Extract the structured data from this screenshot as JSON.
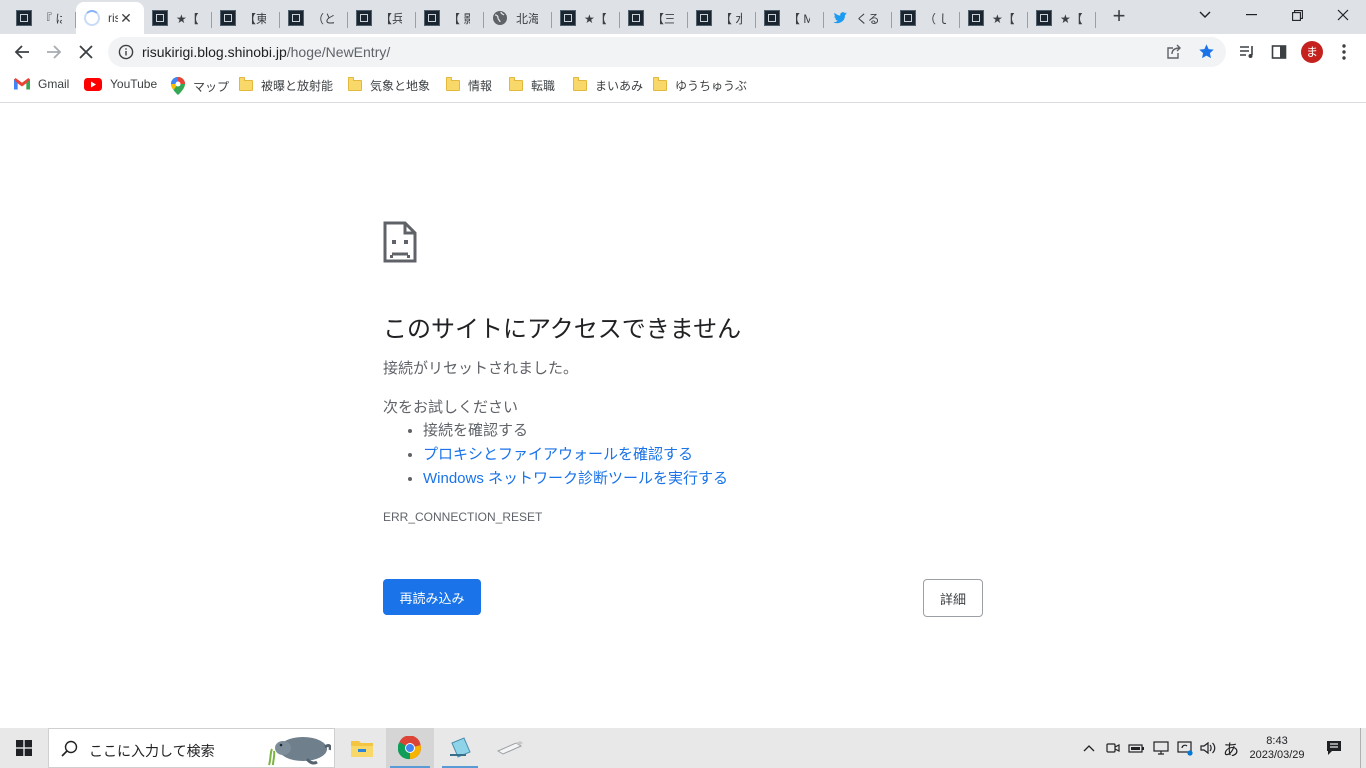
{
  "tabs": [
    {
      "title": "『 は",
      "favicon": "site"
    },
    {
      "title": "ris",
      "favicon": "loading-spinner",
      "active": true
    },
    {
      "title": "★【",
      "favicon": "site"
    },
    {
      "title": "【東京",
      "favicon": "site"
    },
    {
      "title": "（とり",
      "favicon": "site"
    },
    {
      "title": "【兵庫",
      "favicon": "site"
    },
    {
      "title": "【 影",
      "favicon": "site"
    },
    {
      "title": "北海道",
      "favicon": "globe-icon"
    },
    {
      "title": "★【",
      "favicon": "site"
    },
    {
      "title": "【三重",
      "favicon": "site"
    },
    {
      "title": "【 水",
      "favicon": "site"
    },
    {
      "title": "【 M",
      "favicon": "site"
    },
    {
      "title": "くるす",
      "favicon": "twitter-icon"
    },
    {
      "title": "（ し",
      "favicon": "site"
    },
    {
      "title": "★【",
      "favicon": "site"
    },
    {
      "title": "★【",
      "favicon": "site"
    }
  ],
  "toolbar": {
    "url_host": "risukirigi.blog.shinobi.jp",
    "url_path": "/hoge/NewEntry/",
    "profile_initial": "ま"
  },
  "bookmarks": [
    {
      "label": "Gmail",
      "icon": "gmail-icon"
    },
    {
      "label": "YouTube",
      "icon": "youtube-icon"
    },
    {
      "label": "マップ",
      "icon": "maps-icon"
    },
    {
      "label": "被曝と放射能",
      "icon": "folder-icon"
    },
    {
      "label": "気象と地象",
      "icon": "folder-icon"
    },
    {
      "label": "情報",
      "icon": "folder-icon"
    },
    {
      "label": "転職",
      "icon": "folder-icon"
    },
    {
      "label": "まいあみ",
      "icon": "folder-icon"
    },
    {
      "label": "ゆうちゅうぶ",
      "icon": "folder-icon"
    }
  ],
  "error": {
    "title": "このサイトにアクセスできません",
    "subtitle": "接続がリセットされました。",
    "try_heading": "次をお試しください",
    "suggestions": {
      "check_connection": "接続を確認する",
      "check_proxy": "プロキシとファイアウォールを確認する",
      "run_diagnostics": "Windows ネットワーク診断ツールを実行する"
    },
    "code": "ERR_CONNECTION_RESET",
    "reload_label": "再読み込み",
    "details_label": "詳細"
  },
  "taskbar": {
    "search_placeholder": "ここに入力して検索",
    "ime": "あ",
    "time": "8:43",
    "date": "2023/03/29"
  },
  "colors": {
    "accent": "#1a73e8",
    "tabstrip": "#dee1e6",
    "profile": "#c5221f"
  }
}
